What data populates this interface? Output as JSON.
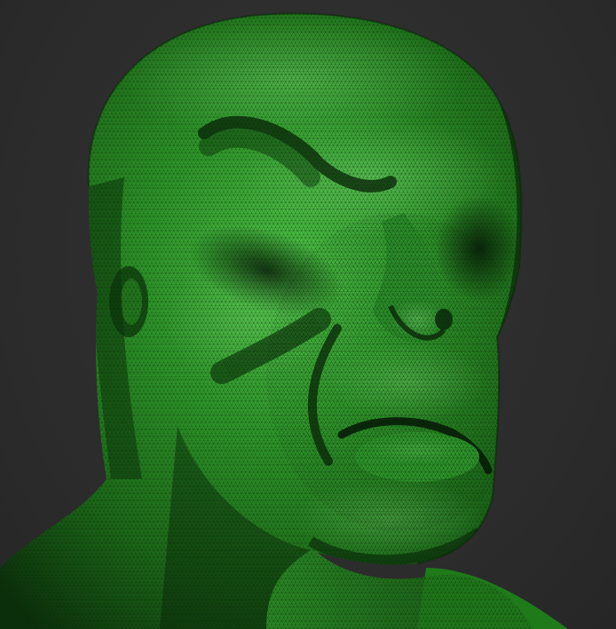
{
  "viewport": {
    "background_color": "#2b2b2b",
    "model_color": "#2f9a2a",
    "model_highlight_color": "#5fd25a",
    "model_shadow_color": "#0a2c09",
    "wireframe_color": "#0b240a",
    "display_mode": "polyframe"
  }
}
